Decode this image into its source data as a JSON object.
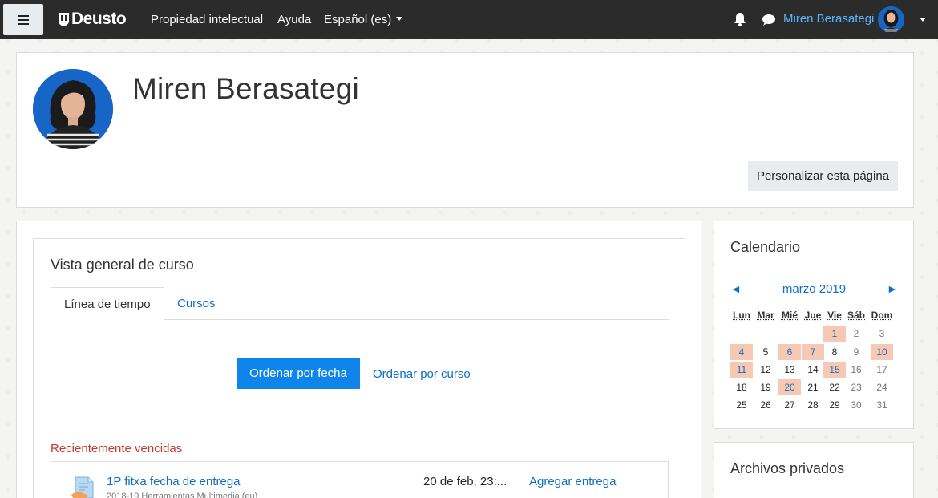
{
  "navbar": {
    "brand": "Deusto",
    "links": [
      "Propiedad intelectual",
      "Ayuda",
      "Español (es)"
    ],
    "user_name": "Miren Berasategi"
  },
  "header": {
    "title": "Miren Berasategi",
    "customize_button": "Personalizar esta página"
  },
  "course_overview": {
    "title": "Vista general de curso",
    "tabs": [
      "Línea de tiempo",
      "Cursos"
    ],
    "sort_by_date": "Ordenar por fecha",
    "sort_by_course": "Ordenar por curso",
    "recent_title": "Recientemente vencidas",
    "event": {
      "name": "1P fitxa fecha de entrega",
      "course": "2018-19 Herramientas Multimedia (eu)",
      "date": "20 de feb, 23:...",
      "action": "Agregar entrega"
    }
  },
  "calendar": {
    "title": "Calendario",
    "prev": "◄",
    "next": "►",
    "month": "marzo 2019",
    "weekdays": [
      "Lun",
      "Mar",
      "Mié",
      "Jue",
      "Vie",
      "Sáb",
      "Dom"
    ],
    "weeks": [
      [
        "",
        "",
        "",
        "",
        "1",
        "2",
        "3"
      ],
      [
        "4",
        "5",
        "6",
        "7",
        "8",
        "9",
        "10"
      ],
      [
        "11",
        "12",
        "13",
        "14",
        "15",
        "16",
        "17"
      ],
      [
        "18",
        "19",
        "20",
        "21",
        "22",
        "23",
        "24"
      ],
      [
        "25",
        "26",
        "27",
        "28",
        "29",
        "30",
        "31"
      ]
    ],
    "event_days": [
      "1",
      "4",
      "6",
      "7",
      "10",
      "11",
      "15",
      "20"
    ],
    "event_color": "#f7c9b5"
  },
  "private_files": {
    "title": "Archivos privados"
  },
  "colors": {
    "navbar_bg": "#2b2b2b",
    "primary": "#0f85ec",
    "link": "#0f6fc5",
    "overdue": "#c0392b"
  }
}
